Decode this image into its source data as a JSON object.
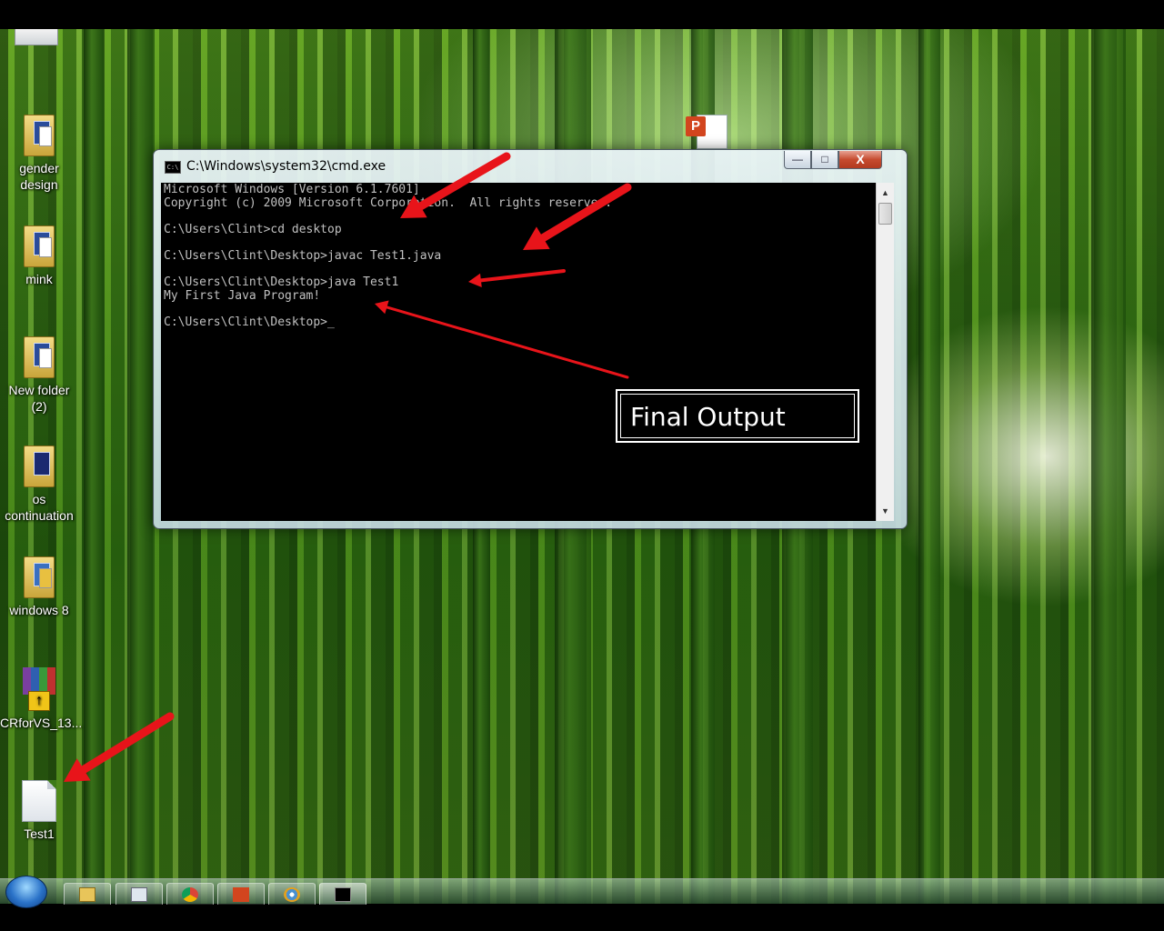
{
  "desktop": {
    "icons": [
      {
        "label": "gender\ndesign"
      },
      {
        "label": "mink"
      },
      {
        "label": "New folder\n(2)"
      },
      {
        "label": "os\ncontinuation"
      },
      {
        "label": "windows 8"
      },
      {
        "label": "CRforVS_13..."
      },
      {
        "label": "Test1"
      }
    ]
  },
  "cmd": {
    "title": "C:\\Windows\\system32\\cmd.exe",
    "lines": [
      "Microsoft Windows [Version 6.1.7601]",
      "Copyright (c) 2009 Microsoft Corporation.  All rights reserved.",
      "",
      "C:\\Users\\Clint>cd desktop",
      "",
      "C:\\Users\\Clint\\Desktop>javac Test1.java",
      "",
      "C:\\Users\\Clint\\Desktop>java Test1",
      "My First Java Program!",
      "",
      "C:\\Users\\Clint\\Desktop>_"
    ],
    "controls": {
      "minimize": "—",
      "maximize": "□",
      "close": "X"
    }
  },
  "annotation": {
    "label": "Final Output",
    "arrow_color": "#e8141a"
  },
  "taskbar": {
    "items": [
      "windows-explorer",
      "notepad",
      "chrome",
      "powerpoint",
      "paint",
      "cmd"
    ]
  }
}
